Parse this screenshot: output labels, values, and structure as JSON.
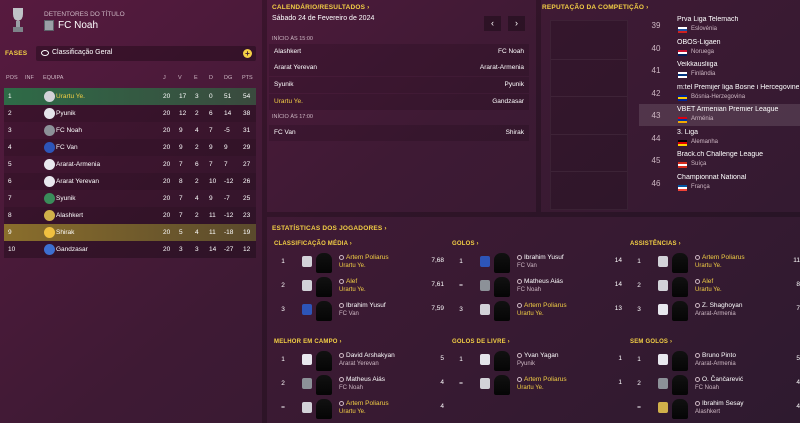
{
  "title_holders": {
    "label": "DETENTORES DO TÍTULO",
    "team": "FC Noah"
  },
  "phases": {
    "label": "FASES",
    "selected": "Classificação Geral",
    "add_icon": "plus-icon"
  },
  "table": {
    "headers": [
      "POS",
      "INF",
      "EQUIPA",
      "J",
      "V",
      "E",
      "D",
      "DG",
      "PTS"
    ],
    "rows": [
      {
        "pos": "1",
        "team": "Urartu Ye.",
        "j": "20",
        "v": "17",
        "e": "3",
        "d": "0",
        "dg": "51",
        "pts": "54",
        "badge": "#d2d2d8",
        "highlight": true
      },
      {
        "pos": "2",
        "team": "Pyunik",
        "j": "20",
        "v": "12",
        "e": "2",
        "d": "6",
        "dg": "14",
        "pts": "38",
        "badge": "#e4e4ea"
      },
      {
        "pos": "3",
        "team": "FC Noah",
        "j": "20",
        "v": "9",
        "e": "4",
        "d": "7",
        "dg": "-5",
        "pts": "31",
        "badge": "#8c9198"
      },
      {
        "pos": "4",
        "team": "FC Van",
        "j": "20",
        "v": "9",
        "e": "2",
        "d": "9",
        "dg": "9",
        "pts": "29",
        "badge": "#2d55b8"
      },
      {
        "pos": "5",
        "team": "Ararat-Armenia",
        "j": "20",
        "v": "7",
        "e": "6",
        "d": "7",
        "dg": "7",
        "pts": "27",
        "badge": "#e8e8ee"
      },
      {
        "pos": "6",
        "team": "Ararat Yerevan",
        "j": "20",
        "v": "8",
        "e": "2",
        "d": "10",
        "dg": "-12",
        "pts": "26",
        "badge": "#e8e8ee"
      },
      {
        "pos": "7",
        "team": "Syunik",
        "j": "20",
        "v": "7",
        "e": "4",
        "d": "9",
        "dg": "-7",
        "pts": "25",
        "badge": "#3a8c5a"
      },
      {
        "pos": "8",
        "team": "Alashkert",
        "j": "20",
        "v": "7",
        "e": "2",
        "d": "11",
        "dg": "-12",
        "pts": "23",
        "badge": "#d0b04a"
      },
      {
        "pos": "9",
        "team": "Shirak",
        "j": "20",
        "v": "5",
        "e": "4",
        "d": "11",
        "dg": "-18",
        "pts": "19",
        "badge": "#f0c040"
      },
      {
        "pos": "10",
        "team": "Gandzasar",
        "j": "20",
        "v": "3",
        "e": "3",
        "d": "14",
        "dg": "-27",
        "pts": "12",
        "badge": "#3d6fd0"
      }
    ]
  },
  "calendar": {
    "title": "CALENDÁRIO/RESULTADOS",
    "date": "Sábado 24 de Fevereiro de 2024",
    "prev_icon": "chevron-left-icon",
    "next_icon": "chevron-right-icon",
    "slot1": "INÍCIO ÀS 15:00",
    "slot2": "INÍCIO ÀS 17:00",
    "matches": [
      {
        "home": "Alashkert",
        "away": "FC Noah"
      },
      {
        "home": "Ararat Yerevan",
        "away": "Ararat-Armenia"
      },
      {
        "home": "Syunik",
        "away": "Pyunik"
      },
      {
        "home": "Urartu Ye.",
        "away": "Gandzasar",
        "home_highlight": true
      },
      {
        "home": "FC Van",
        "away": "Shirak"
      }
    ]
  },
  "reputation": {
    "title": "REPUTAÇÃO DA COMPETIÇÃO",
    "rows": [
      {
        "rank": "39",
        "league": "Prva Liga Telemach",
        "country": "Eslovénia",
        "flag": [
          "#ffffff",
          "#1c4fa0",
          "#d02020"
        ]
      },
      {
        "rank": "40",
        "league": "OBOS-Ligaen",
        "country": "Noruega",
        "flag": [
          "#c8102e",
          "#ffffff",
          "#00205b"
        ]
      },
      {
        "rank": "41",
        "league": "Veikkausliiga",
        "country": "Finlândia",
        "flag": [
          "#ffffff",
          "#003580",
          "#ffffff"
        ]
      },
      {
        "rank": "42",
        "league": "m:tel Premijer liga Bosne i Hercegovine",
        "country": "Bósnia-Herzegovina",
        "flag": [
          "#002395",
          "#fecb00",
          "#002395"
        ]
      },
      {
        "rank": "43",
        "league": "VBET Armenian Premier League",
        "country": "Arménia",
        "flag": [
          "#d90012",
          "#0033a0",
          "#f2a800"
        ],
        "highlight": true
      },
      {
        "rank": "44",
        "league": "3. Liga",
        "country": "Alemanha",
        "flag": [
          "#000000",
          "#dd0000",
          "#ffce00"
        ]
      },
      {
        "rank": "45",
        "league": "Brack.ch Challenge League",
        "country": "Suíça",
        "flag": [
          "#d52b1e",
          "#ffffff",
          "#d52b1e"
        ]
      },
      {
        "rank": "46",
        "league": "Championnat National",
        "country": "França",
        "flag": [
          "#0055a4",
          "#ffffff",
          "#ef4135"
        ]
      }
    ]
  },
  "stats": {
    "title": "ESTATÍSTICAS DOS JOGADORES",
    "blocks": [
      {
        "title": "CLASSIFICAÇÃO MÉDIA",
        "rows": [
          {
            "rank": "1",
            "name": "Artem Poliarus",
            "team": "Urartu Ye.",
            "value": "7,68",
            "y": true,
            "crest": "#d2d2d8"
          },
          {
            "rank": "2",
            "name": "Alef",
            "team": "Urartu Ye.",
            "value": "7,61",
            "y": true,
            "crest": "#d2d2d8"
          },
          {
            "rank": "3",
            "name": "Ibrahim Yusuf",
            "team": "FC Van",
            "value": "7,59",
            "y": false,
            "crest": "#2d55b8"
          }
        ]
      },
      {
        "title": "GOLOS",
        "rows": [
          {
            "rank": "1",
            "name": "Ibrahim Yusuf",
            "team": "FC Van",
            "value": "14",
            "y": false,
            "crest": "#2d55b8"
          },
          {
            "rank": "=",
            "name": "Matheus Aiás",
            "team": "FC Noah",
            "value": "14",
            "y": false,
            "crest": "#8c9198"
          },
          {
            "rank": "3",
            "name": "Artem Poliarus",
            "team": "Urartu Ye.",
            "value": "13",
            "y": true,
            "crest": "#d2d2d8"
          }
        ]
      },
      {
        "title": "ASSISTÊNCIAS",
        "rows": [
          {
            "rank": "1",
            "name": "Artem Poliarus",
            "team": "Urartu Ye.",
            "value": "11",
            "y": true,
            "crest": "#d2d2d8"
          },
          {
            "rank": "2",
            "name": "Alef",
            "team": "Urartu Ye.",
            "value": "8",
            "y": true,
            "crest": "#d2d2d8"
          },
          {
            "rank": "3",
            "name": "Z. Shaghoyan",
            "team": "Ararat-Armenia",
            "value": "7",
            "y": false,
            "crest": "#e8e8ee"
          }
        ]
      },
      {
        "title": "MELHOR EM CAMPO",
        "rows": [
          {
            "rank": "1",
            "name": "David Arshakyan",
            "team": "Ararat Yerevan",
            "value": "5",
            "y": false,
            "crest": "#e8e8ee"
          },
          {
            "rank": "2",
            "name": "Matheus Aiás",
            "team": "FC Noah",
            "value": "4",
            "y": false,
            "crest": "#8c9198"
          },
          {
            "rank": "=",
            "name": "Artem Poliarus",
            "team": "Urartu Ye.",
            "value": "4",
            "y": true,
            "crest": "#d2d2d8"
          }
        ]
      },
      {
        "title": "GOLOS DE LIVRE",
        "rows": [
          {
            "rank": "1",
            "name": "Yvan Yagan",
            "team": "Pyunik",
            "value": "1",
            "y": false,
            "crest": "#e4e4ea"
          },
          {
            "rank": "=",
            "name": "Artem Poliarus",
            "team": "Urartu Ye.",
            "value": "1",
            "y": true,
            "crest": "#d2d2d8"
          }
        ]
      },
      {
        "title": "SEM GOLOS",
        "rows": [
          {
            "rank": "1",
            "name": "Bruno Pinto",
            "team": "Ararat-Armenia",
            "value": "5",
            "y": false,
            "crest": "#e8e8ee"
          },
          {
            "rank": "2",
            "name": "O. Čančarević",
            "team": "FC Noah",
            "value": "4",
            "y": false,
            "crest": "#8c9198"
          },
          {
            "rank": "=",
            "name": "Ibrahim Sesay",
            "team": "Alashkert",
            "value": "4",
            "y": false,
            "crest": "#d0b04a"
          }
        ]
      }
    ]
  },
  "colors": {
    "accent": "#f3cf45",
    "champions": "#2e6b47",
    "relegation": "#8a6e2c"
  }
}
